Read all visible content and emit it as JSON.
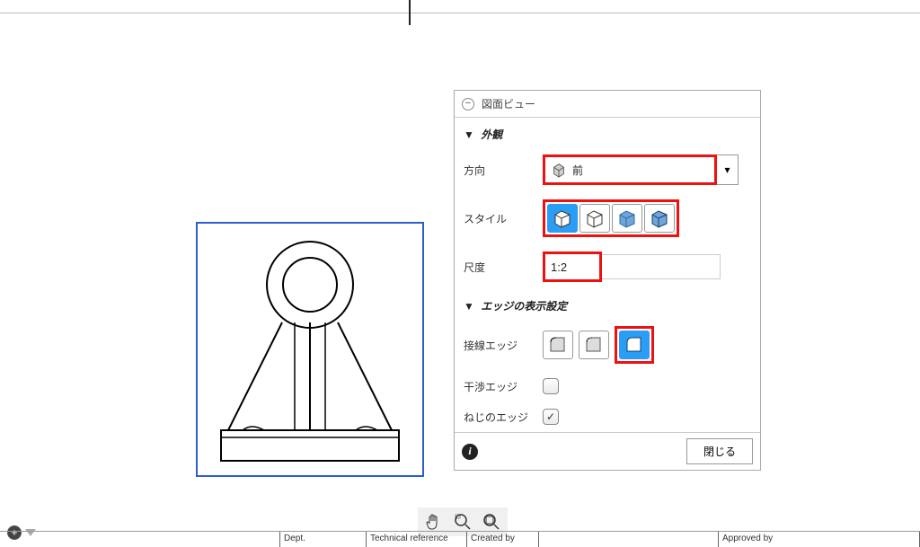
{
  "panel": {
    "title": "図面ビュー",
    "sections": {
      "appearance": "外観",
      "edge_display": "エッジの表示設定"
    },
    "labels": {
      "direction": "方向",
      "style": "スタイル",
      "scale": "尺度",
      "tangent_edge": "接線エッジ",
      "interference_edge": "干渉エッジ",
      "thread_edge": "ねじのエッジ"
    },
    "direction_value": "前",
    "scale_value": "1:2",
    "close_label": "閉じる"
  },
  "titleblock": {
    "dept": "Dept.",
    "techref": "Technical reference",
    "created": "Created by",
    "approved": "Approved by"
  },
  "icons": {
    "hand": "hand-icon",
    "zoom_window": "zoom-window-icon",
    "zoom_fit": "zoom-fit-icon"
  }
}
